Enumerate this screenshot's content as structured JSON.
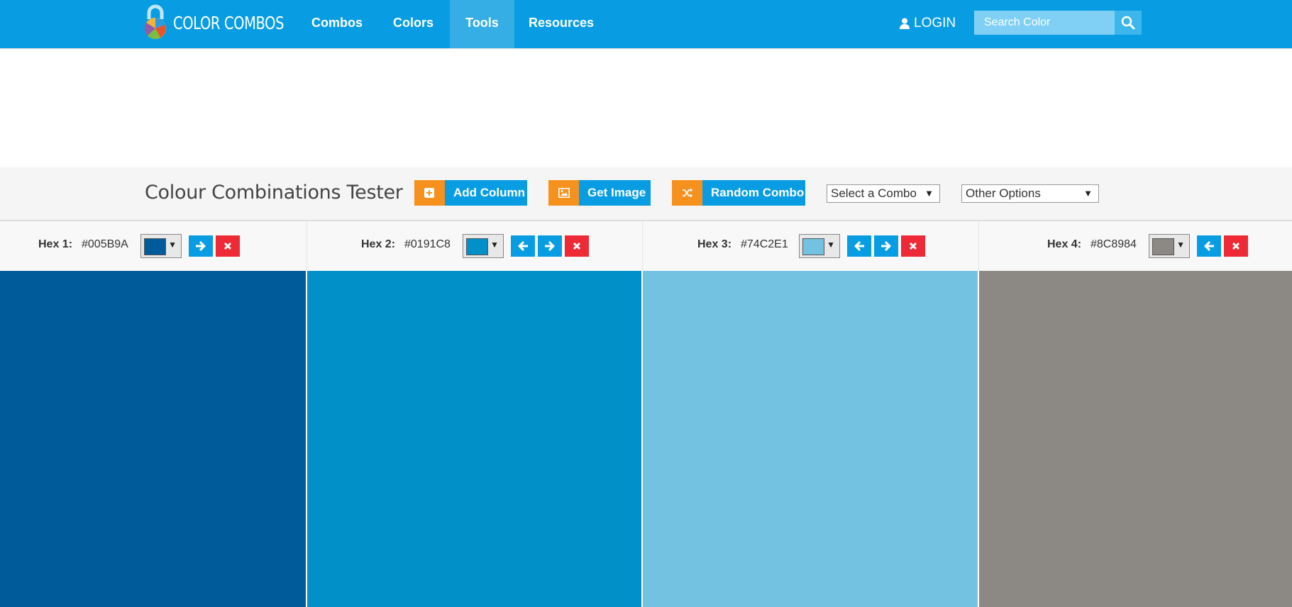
{
  "navbar": {
    "logo_text": "COLOR COMBOS",
    "items": [
      {
        "label": "Combos",
        "active": false
      },
      {
        "label": "Colors",
        "active": false
      },
      {
        "label": "Tools",
        "active": true
      },
      {
        "label": "Resources",
        "active": false
      }
    ],
    "login_label": "LOGIN",
    "search_placeholder": "Search Color"
  },
  "toolbar": {
    "title": "Colour Combinations Tester",
    "buttons": [
      {
        "label": "Add Column",
        "icon": "plus-square-icon"
      },
      {
        "label": "Get Image",
        "icon": "image-icon"
      },
      {
        "label": "Random Combo",
        "icon": "shuffle-icon"
      }
    ],
    "select_combo": "Select a Combo",
    "other_options": "Other Options"
  },
  "columns": [
    {
      "label": "Hex 1:",
      "hex": "#005B9A",
      "color": "#005B9A"
    },
    {
      "label": "Hex 2:",
      "hex": "#0191C8",
      "color": "#0191C8"
    },
    {
      "label": "Hex 3:",
      "hex": "#74C2E1",
      "color": "#74C2E1"
    },
    {
      "label": "Hex 4:",
      "hex": "#8C8984",
      "color": "#8C8984"
    }
  ],
  "colors": {
    "nav_bg": "#089DE3",
    "accent_orange": "#F7911E",
    "delete_red": "#EE2A37"
  }
}
